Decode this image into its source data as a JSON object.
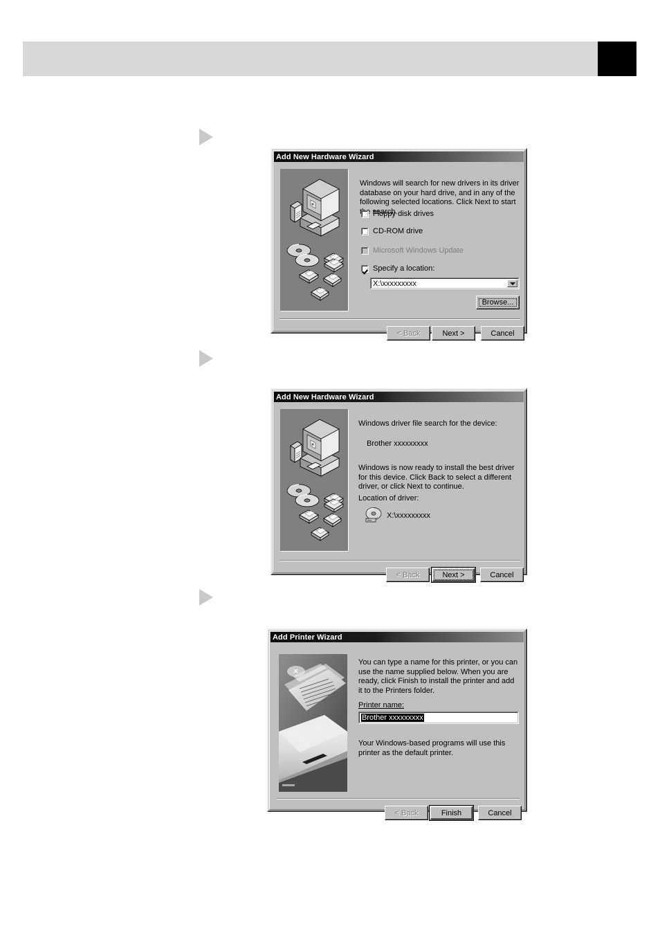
{
  "page": {
    "header_number": "",
    "arrow_marker": "play-triangle"
  },
  "dialogs": [
    {
      "id": "add-new-hardware-wizard-search",
      "title": "Add New Hardware Wizard",
      "intro": "Windows will search for new drivers in its driver database on your hard drive, and in any of the following selected locations. Click Next to start the search.",
      "checkboxes": [
        {
          "label": "Floppy disk drives",
          "accel": "F",
          "checked": false,
          "disabled": false
        },
        {
          "label": "CD-ROM drive",
          "accel": "C",
          "checked": false,
          "disabled": false
        },
        {
          "label": "Microsoft Windows Update",
          "accel": "M",
          "checked": false,
          "disabled": true
        },
        {
          "label": "Specify a location:",
          "accel": "l",
          "checked": true,
          "disabled": false
        }
      ],
      "location_value": "X:\\xxxxxxxxx",
      "browse_label": "Browse...",
      "buttons": [
        {
          "label": "< Back",
          "state": "disabled"
        },
        {
          "label": "Next >",
          "state": "normal"
        },
        {
          "label": "Cancel",
          "state": "normal"
        }
      ],
      "illustration": "computer-with-disks-illustration"
    },
    {
      "id": "add-new-hardware-wizard-ready",
      "title": "Add New Hardware Wizard",
      "search_label": "Windows driver file search for the device:",
      "device_name": "Brother xxxxxxxxx",
      "ready_text": "Windows is now ready to install the best driver for this device. Click Back to select a different driver, or click Next to continue.",
      "location_label": "Location of driver:",
      "location_value": "X:\\xxxxxxxxx",
      "buttons": [
        {
          "label": "< Back",
          "state": "disabled"
        },
        {
          "label": "Next >",
          "state": "default"
        },
        {
          "label": "Cancel",
          "state": "normal"
        }
      ],
      "illustration": "computer-with-disks-illustration"
    },
    {
      "id": "add-printer-wizard",
      "title": "Add Printer Wizard",
      "intro": "You can type a name for this printer, or you can use the name supplied below. When you are ready, click Finish to install the printer and add it to the Printers folder.",
      "printer_name_label": "Printer name:",
      "printer_name_accel": "P",
      "printer_name_value": "Brother xxxxxxxxx",
      "default_note": "Your Windows-based programs will use this printer as the default printer.",
      "buttons": [
        {
          "label": "< Back",
          "state": "disabled"
        },
        {
          "label": "Finish",
          "state": "default"
        },
        {
          "label": "Cancel",
          "state": "normal"
        }
      ],
      "illustration": "printer-photo"
    }
  ],
  "colors": {
    "dialog_face": "#c0c0c0",
    "illustration_bg": "#808080",
    "header_band": "#d8d8d8",
    "header_marker": "#000000",
    "arrow": "#c9c9c9"
  }
}
